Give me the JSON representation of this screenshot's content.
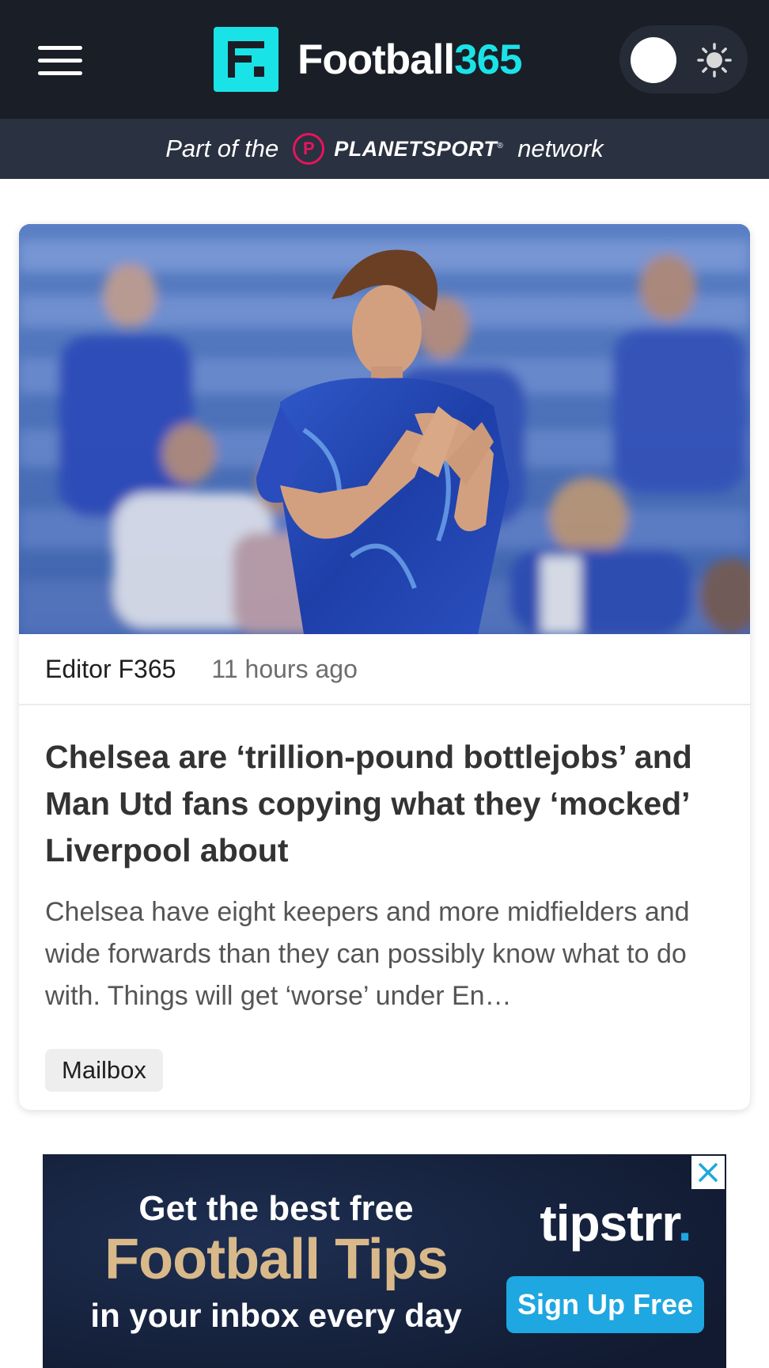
{
  "header": {
    "brand_word": "Football",
    "brand_number": "365",
    "network_prefix": "Part of the",
    "network_name": "PLANETSPORT",
    "network_trademark": "®",
    "network_badge": "P",
    "network_suffix": "network"
  },
  "article": {
    "author": "Editor F365",
    "time": "11 hours ago",
    "headline": "Chelsea are ‘trillion-pound bottlejobs’ and Man Utd fans copying what they ‘mocked’ Liverpool about",
    "summary": "Chelsea have eight keepers and more midfielders and wide forwards than they can possibly know what to do with. Things will get ‘worse’ under En…",
    "tag": "Mailbox"
  },
  "ad": {
    "line1": "Get the best free",
    "line2": "Football Tips",
    "line3": "in your inbox every day",
    "brand": "tipstrr",
    "brand_dot": ".",
    "cta": "Sign Up Free"
  },
  "colors": {
    "header_bg": "#1a1e26",
    "accent": "#1ae3e8",
    "network_bg": "#2a3140",
    "planetsport": "#e8145c",
    "ad_cta": "#1ea7e0",
    "ad_gold": "#d9b98a"
  },
  "icons": [
    "hamburger-menu-icon",
    "football365-logo-icon",
    "sun-icon",
    "planetsport-logo-icon",
    "close-icon"
  ]
}
